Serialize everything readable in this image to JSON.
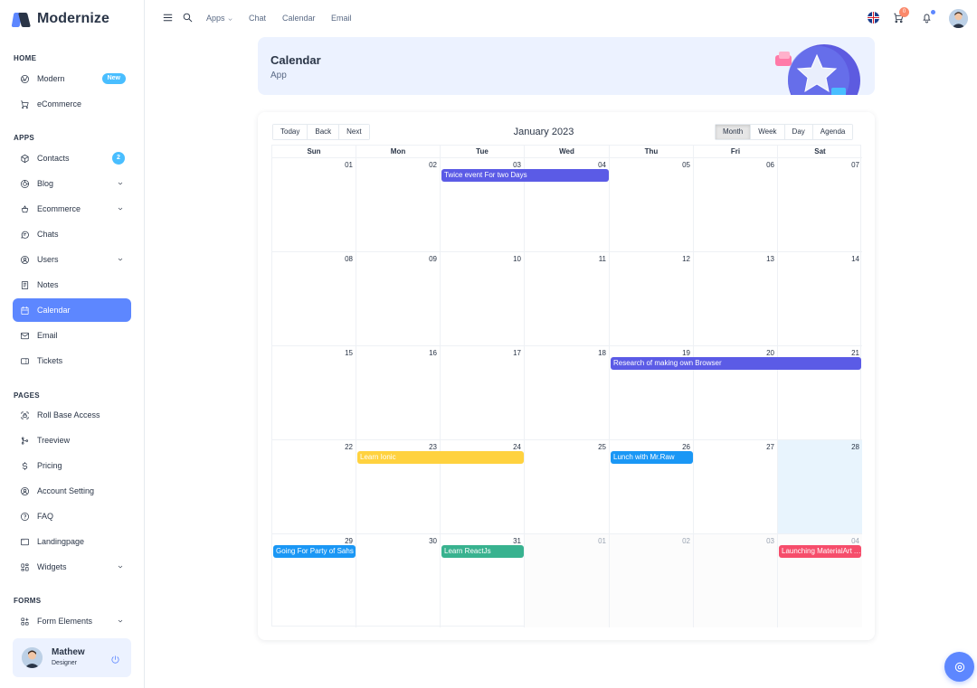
{
  "brand": {
    "name": "Modernize"
  },
  "sidebar": {
    "captions": [
      "HOME",
      "APPS",
      "PAGES",
      "FORMS"
    ],
    "items": [
      {
        "label": "Modern",
        "icon": "aperture-icon",
        "badge": "New"
      },
      {
        "label": "eCommerce",
        "icon": "shopping-cart-icon"
      },
      {
        "label": "Contacts",
        "icon": "package-icon",
        "badge": "2"
      },
      {
        "label": "Blog",
        "icon": "chart-donut-icon",
        "chevron": true
      },
      {
        "label": "Ecommerce",
        "icon": "basket-icon",
        "chevron": true
      },
      {
        "label": "Chats",
        "icon": "message-icon"
      },
      {
        "label": "Users",
        "icon": "user-circle-icon",
        "chevron": true
      },
      {
        "label": "Notes",
        "icon": "notes-icon"
      },
      {
        "label": "Calendar",
        "icon": "calendar-icon",
        "active": true
      },
      {
        "label": "Email",
        "icon": "mail-icon"
      },
      {
        "label": "Tickets",
        "icon": "ticket-icon"
      },
      {
        "label": "Roll Base Access",
        "icon": "lock-access-icon"
      },
      {
        "label": "Treeview",
        "icon": "git-merge-icon"
      },
      {
        "label": "Pricing",
        "icon": "currency-dollar-icon"
      },
      {
        "label": "Account Setting",
        "icon": "user-circle-icon"
      },
      {
        "label": "FAQ",
        "icon": "help-icon"
      },
      {
        "label": "Landingpage",
        "icon": "app-window-icon"
      },
      {
        "label": "Widgets",
        "icon": "layout-icon",
        "chevron": true
      },
      {
        "label": "Form Elements",
        "icon": "apps-icon",
        "chevron": true
      }
    ]
  },
  "profile": {
    "name": "Mathew",
    "role": "Designer"
  },
  "header": {
    "links": [
      "Apps",
      "Chat",
      "Calendar",
      "Email"
    ],
    "cart_count": "0"
  },
  "banner": {
    "title": "Calendar",
    "subtitle": "App"
  },
  "calendar": {
    "toolbar": {
      "nav": [
        "Today",
        "Back",
        "Next"
      ],
      "views": [
        "Month",
        "Week",
        "Day",
        "Agenda"
      ],
      "active_view": "Month"
    },
    "label": "January 2023",
    "weekdays": [
      "Sun",
      "Mon",
      "Tue",
      "Wed",
      "Thu",
      "Fri",
      "Sat"
    ],
    "weeks": [
      [
        "01",
        "02",
        "03",
        "04",
        "05",
        "06",
        "07"
      ],
      [
        "08",
        "09",
        "10",
        "11",
        "12",
        "13",
        "14"
      ],
      [
        "15",
        "16",
        "17",
        "18",
        "19",
        "20",
        "21"
      ],
      [
        "22",
        "23",
        "24",
        "25",
        "26",
        "27",
        "28"
      ],
      [
        "29",
        "30",
        "31",
        "01",
        "02",
        "03",
        "04"
      ]
    ],
    "today": {
      "week": 3,
      "day": 6
    },
    "events": [
      {
        "title": "Twice event For two Days",
        "week": 0,
        "start": 2,
        "span": 2,
        "color": "#5b5be6"
      },
      {
        "title": "Research of making own Browser",
        "week": 2,
        "start": 4,
        "span": 3,
        "color": "#5b5be6"
      },
      {
        "title": "Learn Ionic",
        "week": 3,
        "start": 1,
        "span": 2,
        "color": "#ffd23f"
      },
      {
        "title": "Lunch with Mr.Raw",
        "week": 3,
        "start": 4,
        "span": 1,
        "color": "#1a97f5"
      },
      {
        "title": "Going For Party of Sahs",
        "week": 4,
        "start": 0,
        "span": 1,
        "color": "#1a97f5"
      },
      {
        "title": "Learn ReactJs",
        "week": 4,
        "start": 2,
        "span": 1,
        "color": "#38b28f"
      },
      {
        "title": "Launching MaterialArt Angular",
        "week": 4,
        "start": 6,
        "span": 1,
        "color": "#f64d6b"
      }
    ]
  },
  "colors": {
    "primary": "#5d87ff",
    "secondary": "#49beff",
    "text": "#2a3547",
    "banner_bg": "#ecf2ff"
  }
}
